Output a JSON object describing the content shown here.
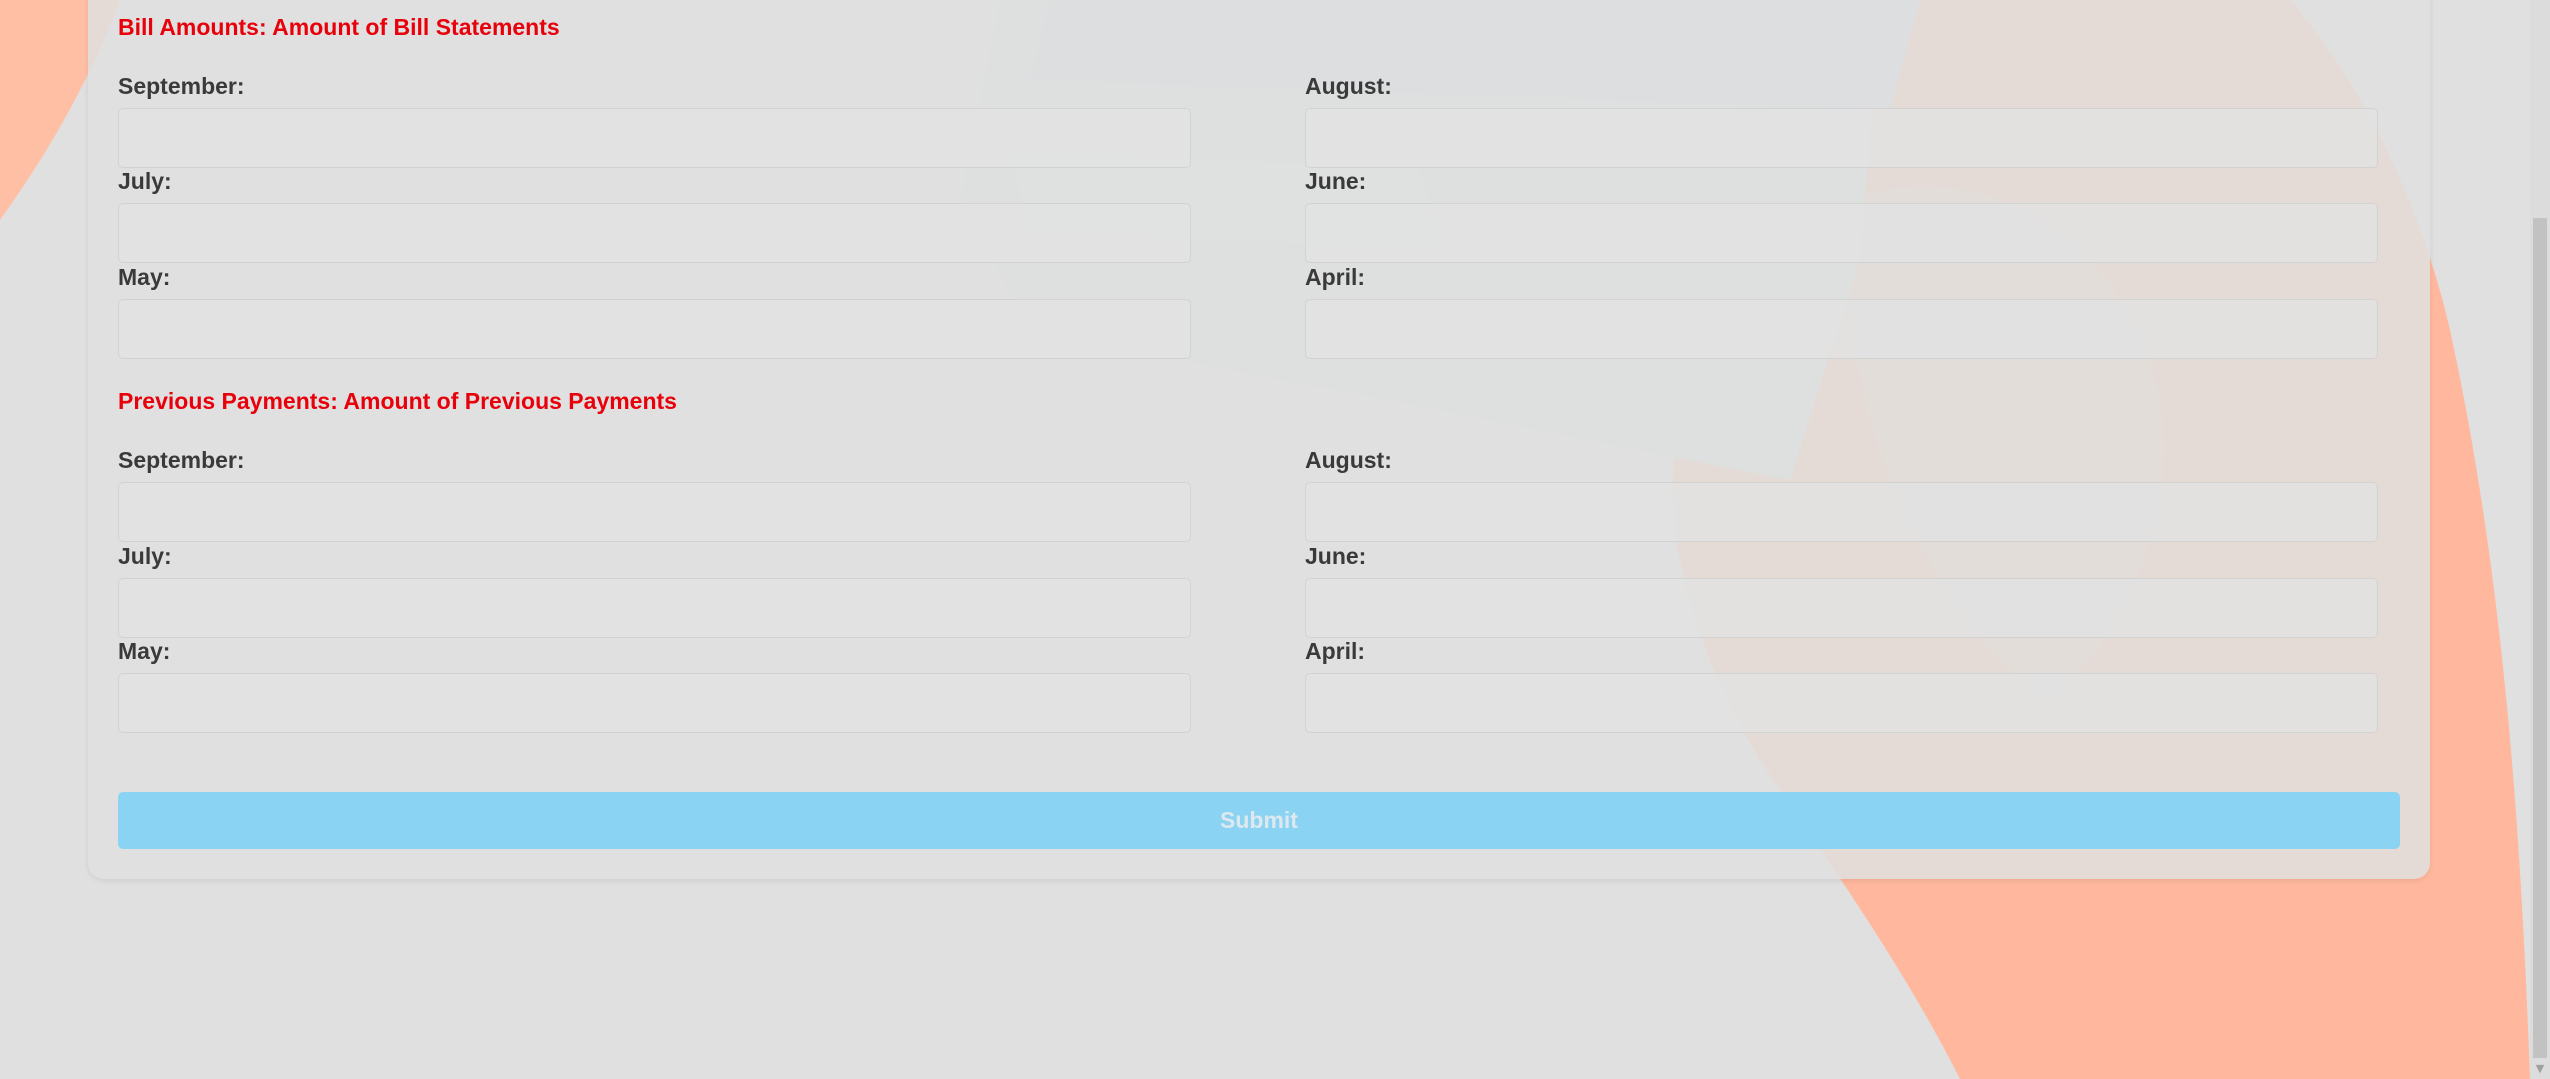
{
  "bill_section": {
    "title": "Bill Amounts: Amount of Bill Statements",
    "fields": [
      {
        "label": "September:",
        "value": ""
      },
      {
        "label": "August:",
        "value": ""
      },
      {
        "label": "July:",
        "value": ""
      },
      {
        "label": "June:",
        "value": ""
      },
      {
        "label": "May:",
        "value": ""
      },
      {
        "label": "April:",
        "value": ""
      }
    ]
  },
  "payment_section": {
    "title": "Previous Payments: Amount of Previous Payments",
    "fields": [
      {
        "label": "September:",
        "value": ""
      },
      {
        "label": "August:",
        "value": ""
      },
      {
        "label": "July:",
        "value": ""
      },
      {
        "label": "June:",
        "value": ""
      },
      {
        "label": "May:",
        "value": ""
      },
      {
        "label": "April:",
        "value": ""
      }
    ]
  },
  "submit": {
    "label": "Submit"
  },
  "colors": {
    "section_title": "#e8000b",
    "submit_button": "#8bd3f2",
    "background": "#e0e0e0",
    "decor_orange": "#ffb89d",
    "decor_green": "#cfe4d8",
    "decor_blue": "#cfd6e0"
  }
}
